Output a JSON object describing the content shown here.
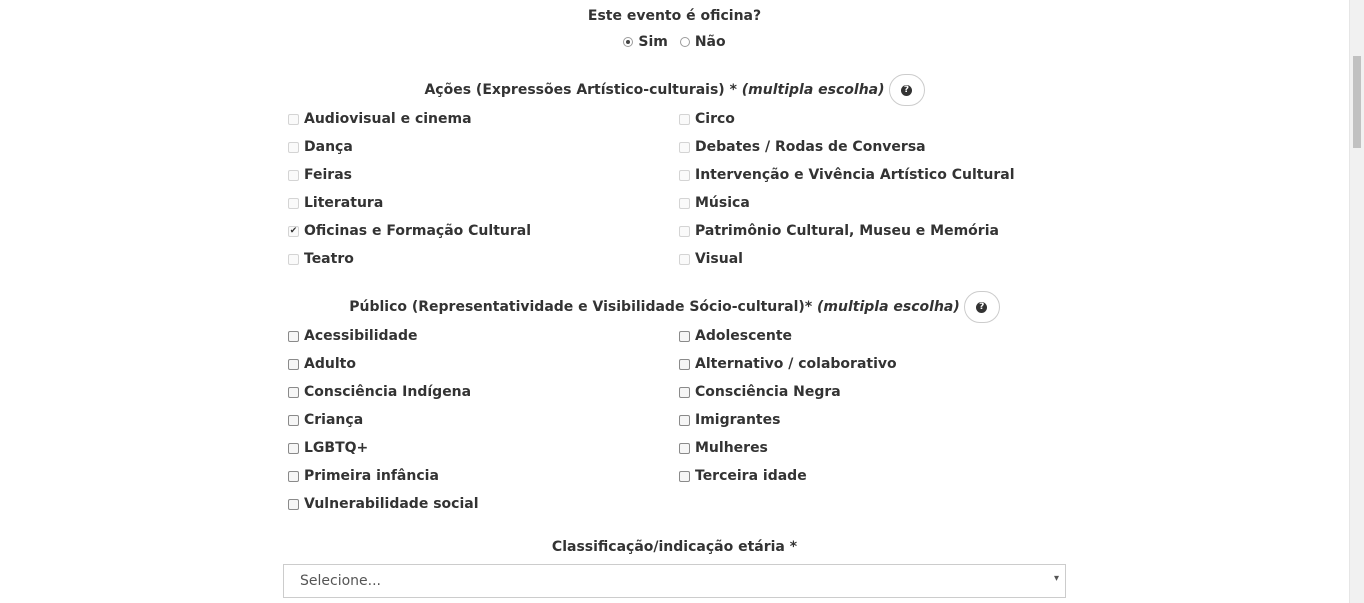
{
  "oficina": {
    "question": "Este evento é oficina?",
    "options": [
      {
        "label": "Sim",
        "checked": true
      },
      {
        "label": "Não",
        "checked": false
      }
    ]
  },
  "acoes": {
    "title": "Ações (Expressões Artístico-culturais) *",
    "title_em": "(multipla escolha)",
    "help_icon": "question-circle-icon",
    "left": [
      "Audiovisual e cinema",
      "Dança",
      "Feiras",
      "Literatura",
      "Oficinas e Formação Cultural",
      "Teatro"
    ],
    "right": [
      "Circo",
      "Debates / Rodas de Conversa",
      "Intervenção e Vivência Artístico Cultural",
      "Música",
      "Patrimônio Cultural, Museu e Memória",
      "Visual"
    ],
    "checked": [
      "Oficinas e Formação Cultural"
    ]
  },
  "publico": {
    "title": "Público (Representatividade e Visibilidade Sócio-cultural)*",
    "title_em": "(multipla escolha)",
    "help_icon": "question-circle-icon",
    "left": [
      "Acessibilidade",
      "Adulto",
      "Consciência Indígena",
      "Criança",
      "LGBTQ+",
      "Primeira infância",
      "Vulnerabilidade social"
    ],
    "right": [
      "Adolescente",
      "Alternativo / colaborativo",
      "Consciência Negra",
      "Imigrantes",
      "Mulheres",
      "Terceira idade"
    ],
    "checked": []
  },
  "classificacao": {
    "label": "Classificação/indicação etária *",
    "select_value": "Selecione...",
    "arrow": "▾"
  }
}
